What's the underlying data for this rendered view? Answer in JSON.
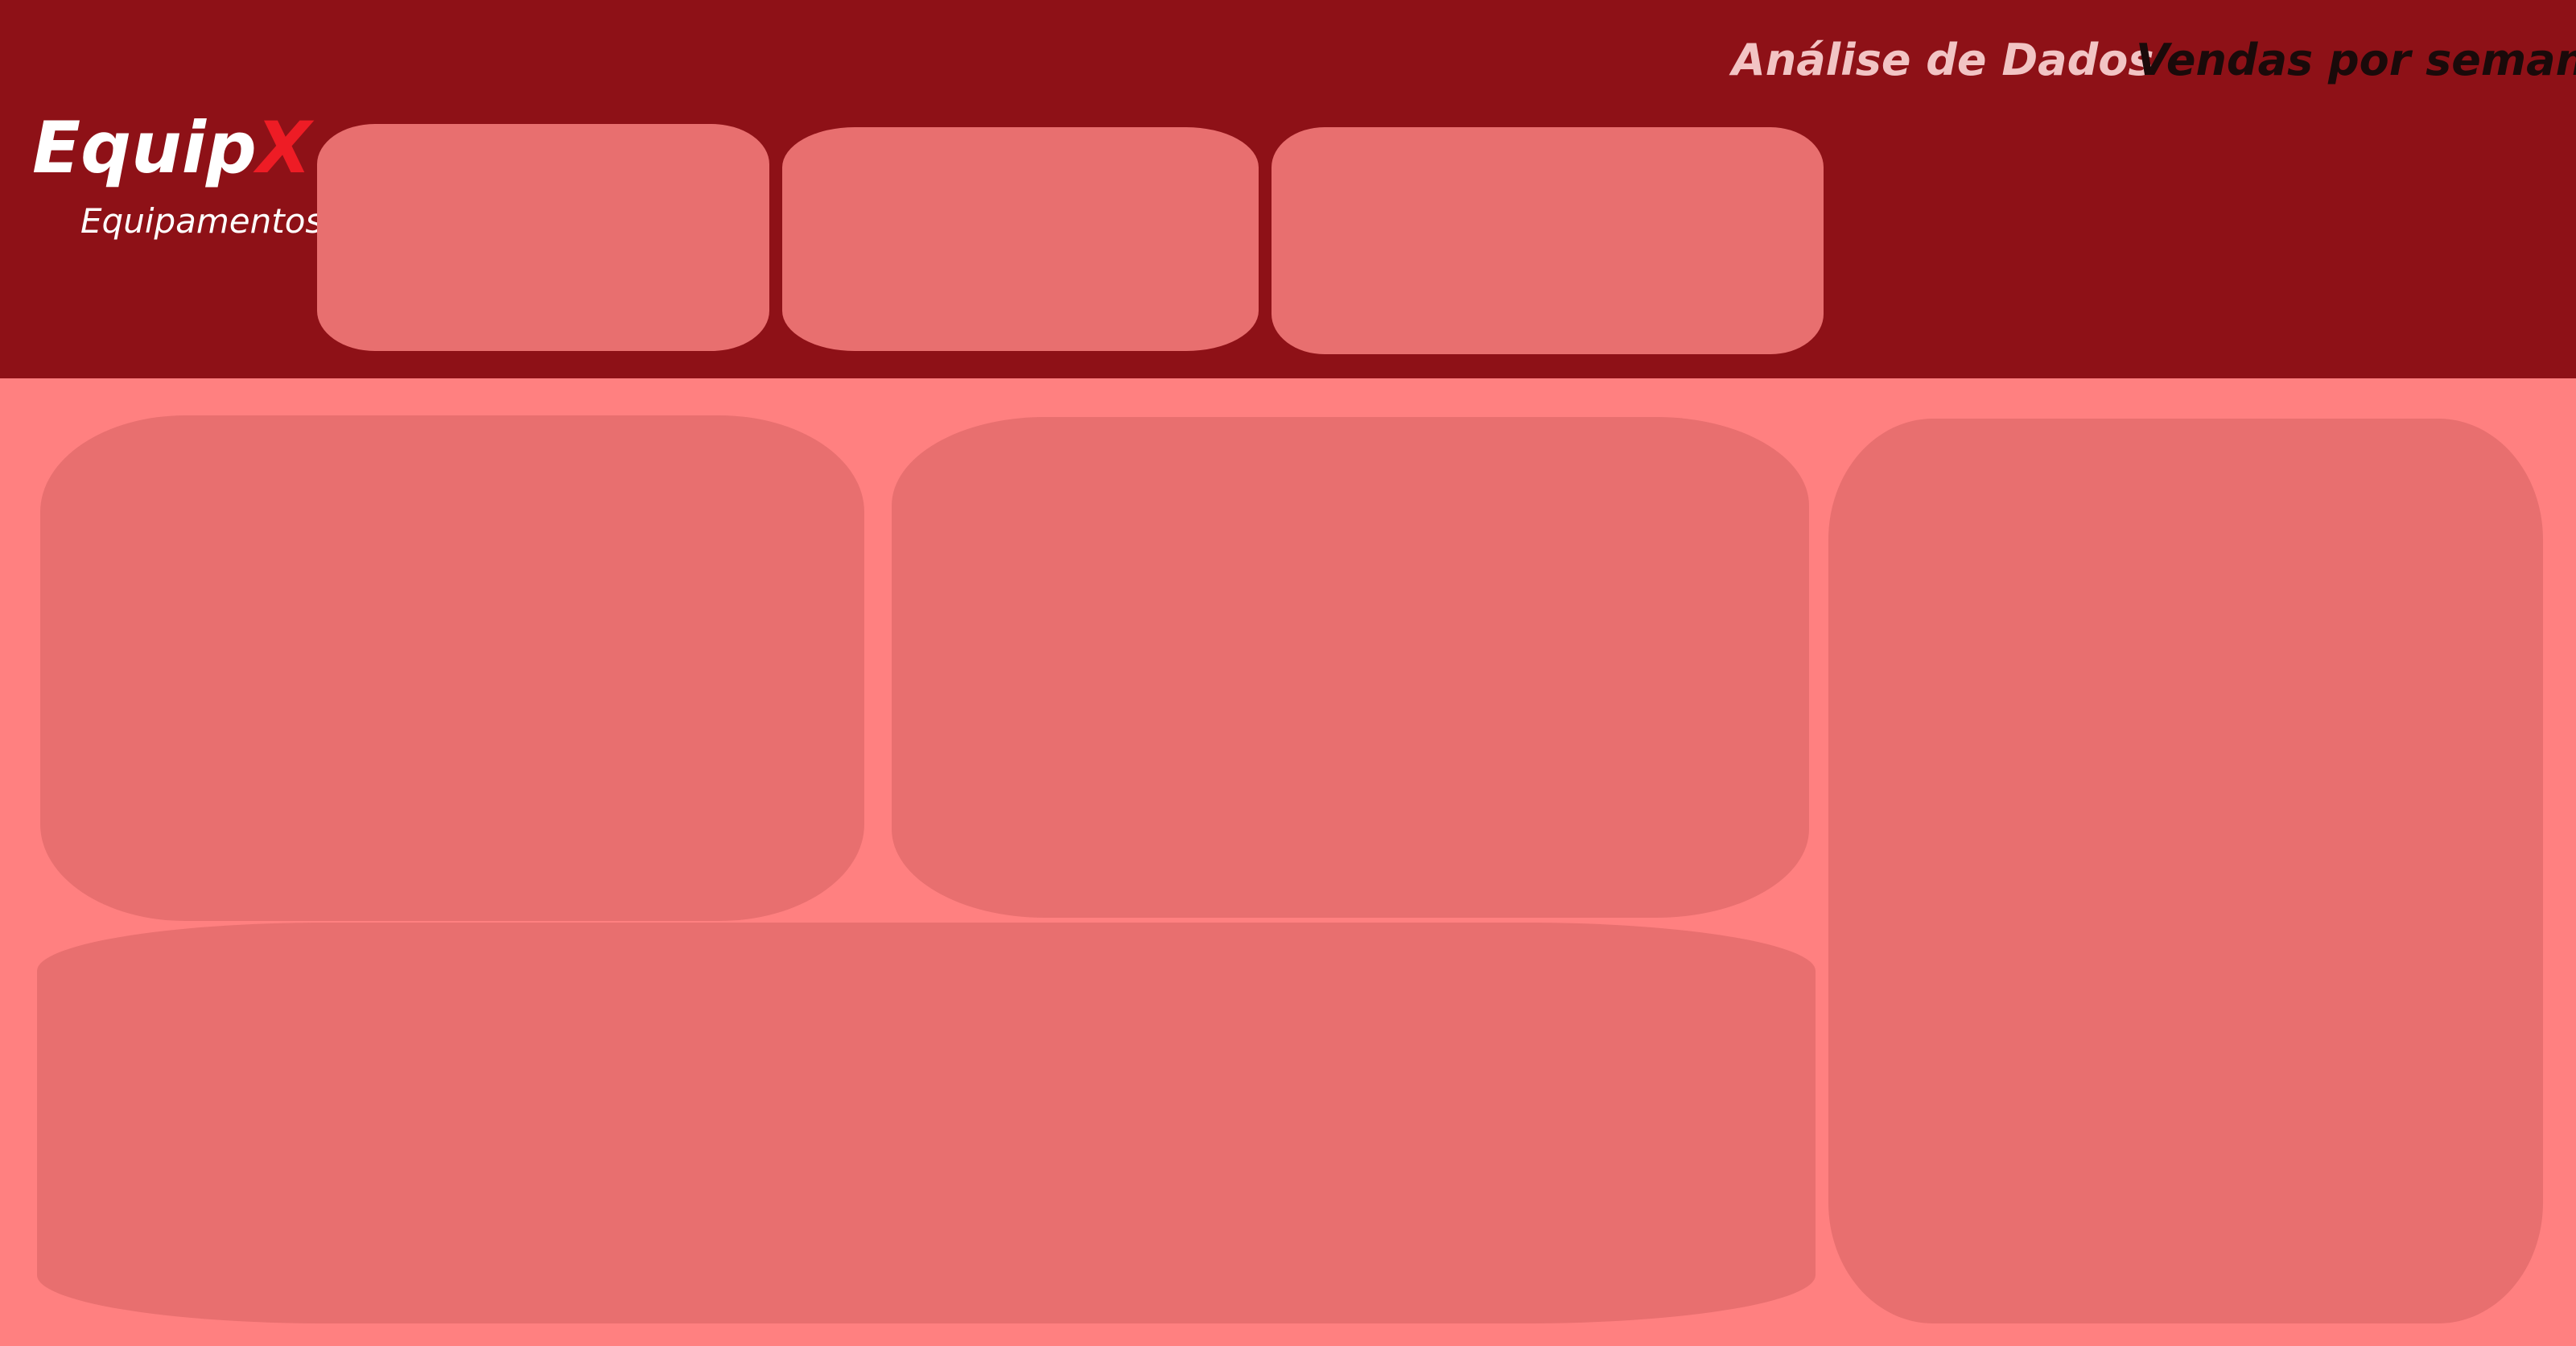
{
  "brand": {
    "name_main": "Equip",
    "name_accent": "X",
    "tagline": "Equipamentos"
  },
  "header": {
    "title_primary": "Análise de Dados",
    "title_secondary": "Vendas por semana"
  },
  "colors": {
    "header_bg": "#8E1117",
    "page_bg": "#FF8080",
    "card_bg": "#E86F6F",
    "brand_accent": "#EE1C25",
    "title_primary_text": "#F2C4C4",
    "title_secondary_text": "#1A0A0A"
  }
}
